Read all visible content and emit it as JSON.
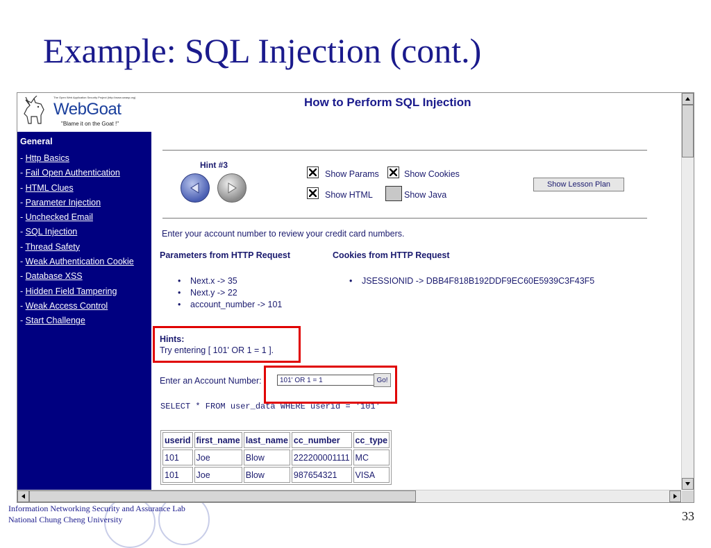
{
  "slide": {
    "title": "Example: SQL Injection (cont.)",
    "footer_line1": "Information Networking Security and Assurance Lab",
    "footer_line2": "National Chung Cheng University",
    "page_number": "33"
  },
  "logo": {
    "tiny_text": "The Open Web Application Security Project (http://www.owasp.org)",
    "title": "WebGoat",
    "tagline": "\"Blame it on the Goat !\""
  },
  "sidebar": {
    "heading": "General",
    "prefix": "- ",
    "items": [
      {
        "label": "Http Basics"
      },
      {
        "label": "Fail Open Authentication"
      },
      {
        "label": "HTML Clues"
      },
      {
        "label": "Parameter Injection"
      },
      {
        "label": "Unchecked Email"
      },
      {
        "label": "SQL Injection"
      },
      {
        "label": "Thread Safety"
      },
      {
        "label": "Weak Authentication Cookie"
      },
      {
        "label": "Database XSS"
      },
      {
        "label": "Hidden Field Tampering"
      },
      {
        "label": "Weak Access Control"
      },
      {
        "label": "Start Challenge"
      }
    ]
  },
  "main": {
    "title": "How to Perform SQL Injection",
    "hint_label": "Hint #3",
    "options": {
      "show_params": {
        "label": "Show Params",
        "checked": true
      },
      "show_cookies": {
        "label": "Show Cookies",
        "checked": true
      },
      "show_html": {
        "label": "Show HTML",
        "checked": true
      },
      "show_java": {
        "label": "Show Java",
        "checked": false
      }
    },
    "lesson_plan_button": "Show Lesson Plan",
    "intro": "Enter your account number to review your credit card numbers.",
    "params_heading": "Parameters from HTTP Request",
    "cookies_heading": "Cookies from HTTP Request",
    "params": [
      "Next.x -> 35",
      "Next.y -> 22",
      "account_number -> 101"
    ],
    "cookies": [
      "JSESSIONID -> DBB4F818B192DDF9EC60E5939C3F43F5"
    ],
    "hints_heading": "Hints:",
    "hints_text": "Try entering [ 101' OR 1 = 1 ].",
    "account_label": "Enter an Account Number:",
    "account_value": "101' OR 1 = 1",
    "go_button": "Go!",
    "sql": "SELECT * FROM user_data WHERE userid = '101'",
    "table": {
      "headers": [
        "userid",
        "first_name",
        "last_name",
        "cc_number",
        "cc_type"
      ],
      "rows": [
        [
          "101",
          "Joe",
          "Blow",
          "222200001111",
          "MC"
        ],
        [
          "101",
          "Joe",
          "Blow",
          "987654321",
          "VISA"
        ]
      ]
    }
  },
  "colors": {
    "sidebar_bg": "#000080",
    "title_color": "#1a1a8c",
    "highlight_box": "#e00000"
  }
}
